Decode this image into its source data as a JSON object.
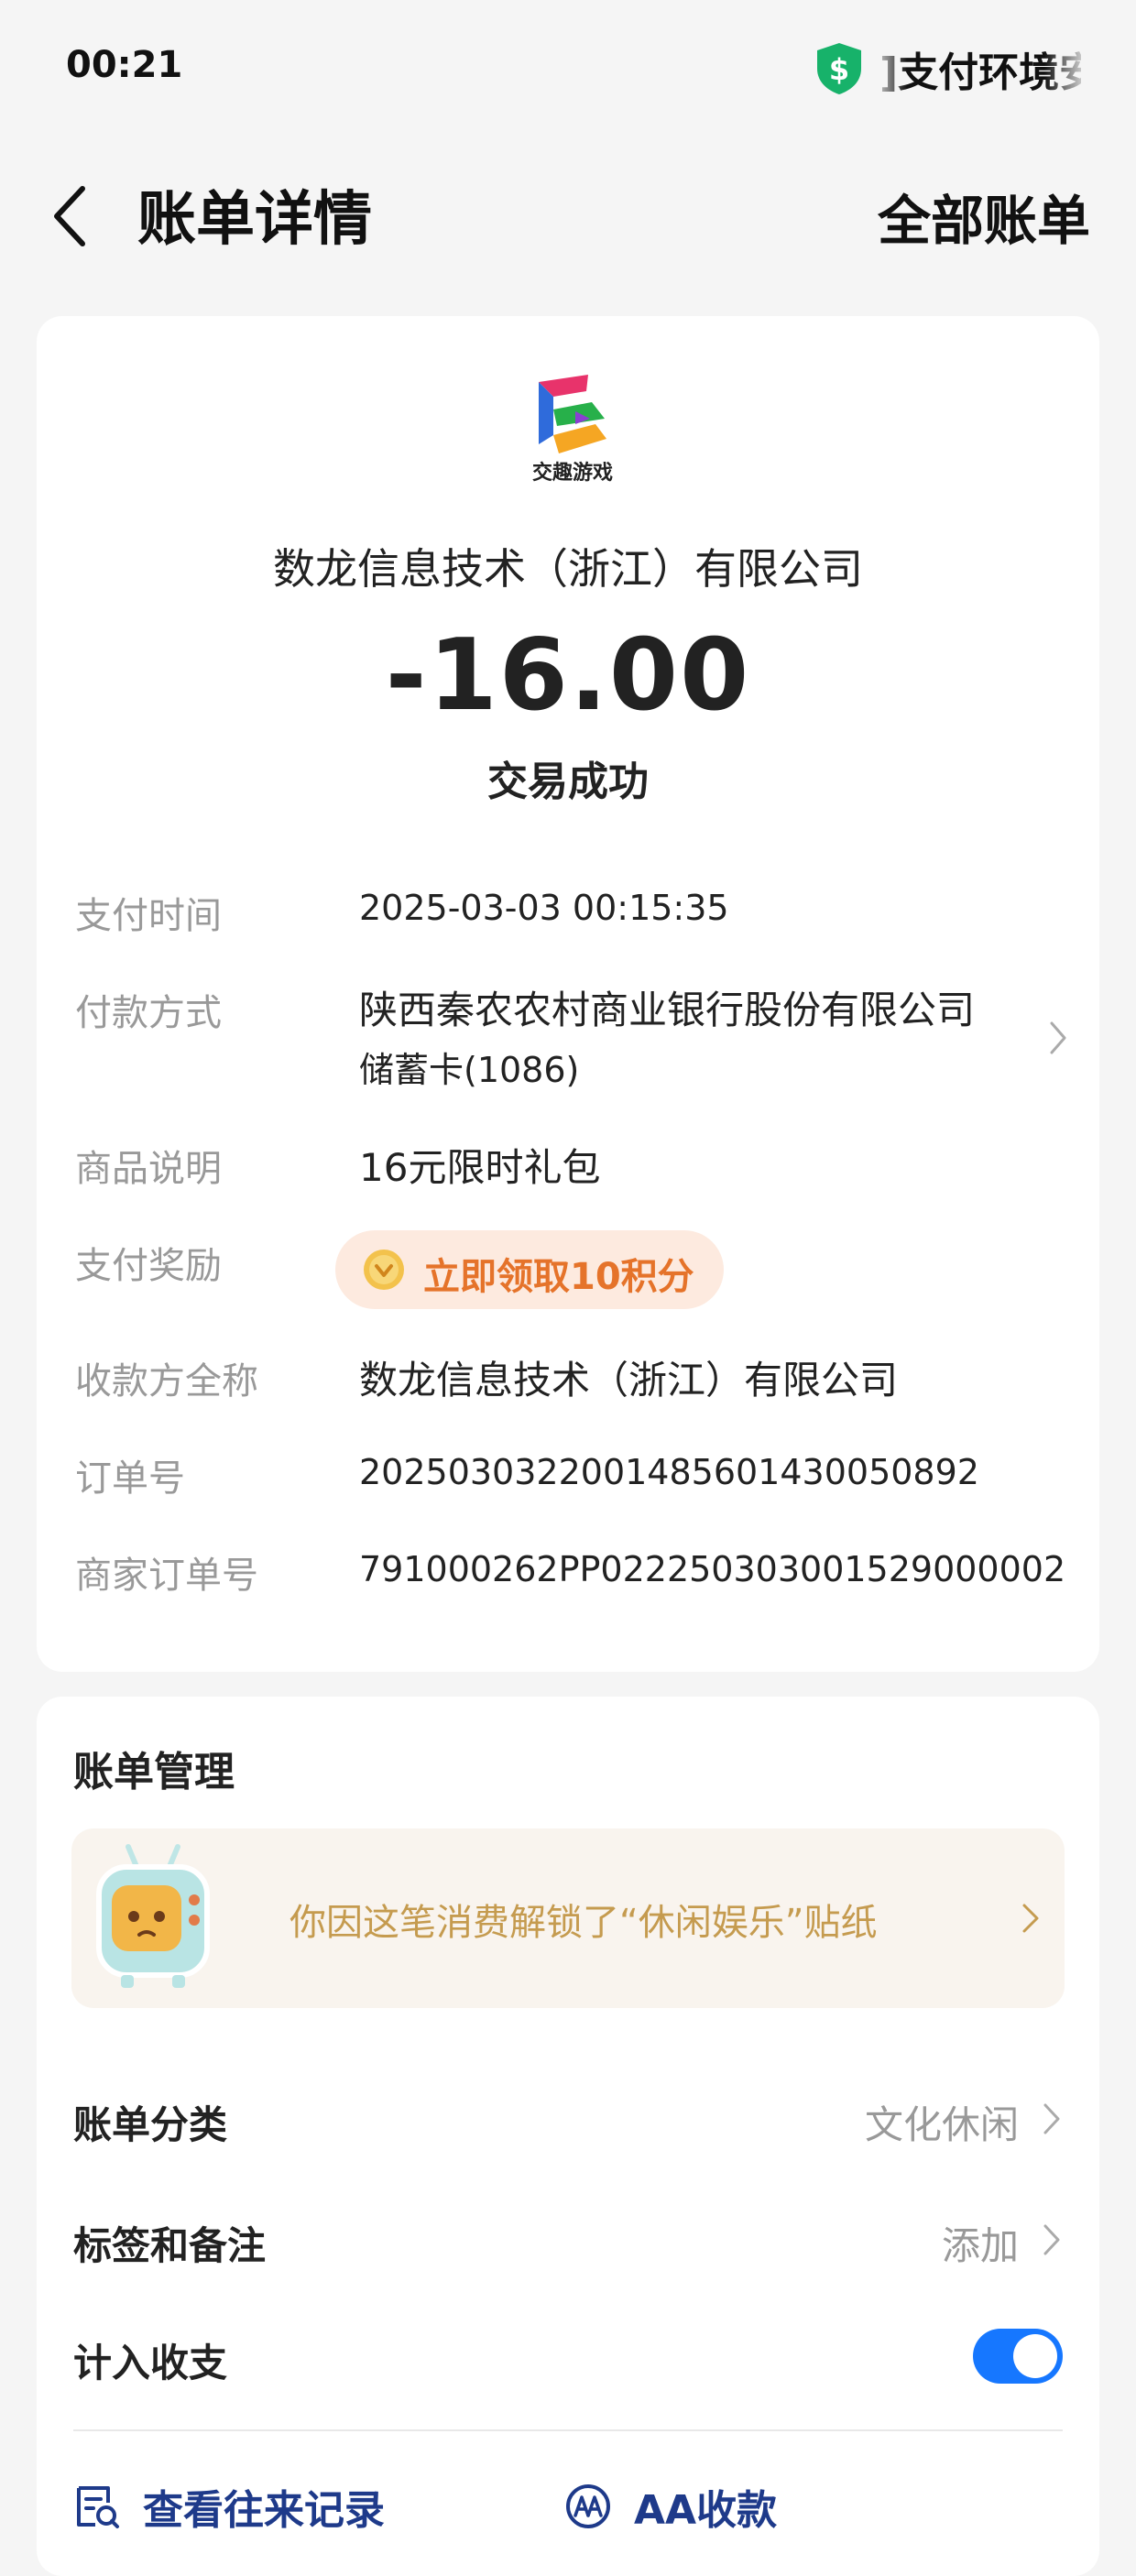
{
  "status_bar": {
    "time": "00:21",
    "right_text": "]支付环境安全"
  },
  "nav": {
    "title": "账单详情",
    "right_link": "全部账单"
  },
  "merchant": {
    "logo_text": "交趣游戏",
    "name": "数龙信息技术（浙江）有限公司",
    "amount": "-16.00",
    "status": "交易成功"
  },
  "details": {
    "pay_time_label": "支付时间",
    "pay_time": "2025-03-03 00:15:35",
    "pay_method_label": "付款方式",
    "pay_method_line1": "陕西秦农农村商业银行股份有限公司",
    "pay_method_line2": "储蓄卡(1086)",
    "goods_label": "商品说明",
    "goods": "16元限时礼包",
    "reward_label": "支付奖励",
    "reward_button": "立即领取10积分",
    "payee_label": "收款方全称",
    "payee": "数龙信息技术（浙江）有限公司",
    "order_label": "订单号",
    "order_no": "2025030322001485601430050892",
    "merchant_order_label": "商家订单号",
    "merchant_order_no": "791000262PP022250303001529000002"
  },
  "manage": {
    "title": "账单管理",
    "sticker_text": "你因这笔消费解锁了“休闲娱乐”贴纸",
    "category_label": "账单分类",
    "category_value": "文化休闲",
    "tags_label": "标签和备注",
    "tags_value": "添加",
    "count_label": "计入收支",
    "count_enabled": true,
    "history_label": "查看往来记录",
    "aa_label": "AA收款"
  },
  "colors": {
    "accent": "#1677ff",
    "reward_orange": "#e5732a",
    "sticker_gold": "#c59b4f",
    "safe_green": "#17b26a"
  },
  "icons": [
    "shield-dollar-icon",
    "back-arrow-icon",
    "merchant-logo",
    "coin-icon",
    "tv-sticker-icon",
    "chevron-right-icon",
    "search-list-icon",
    "aa-icon"
  ]
}
